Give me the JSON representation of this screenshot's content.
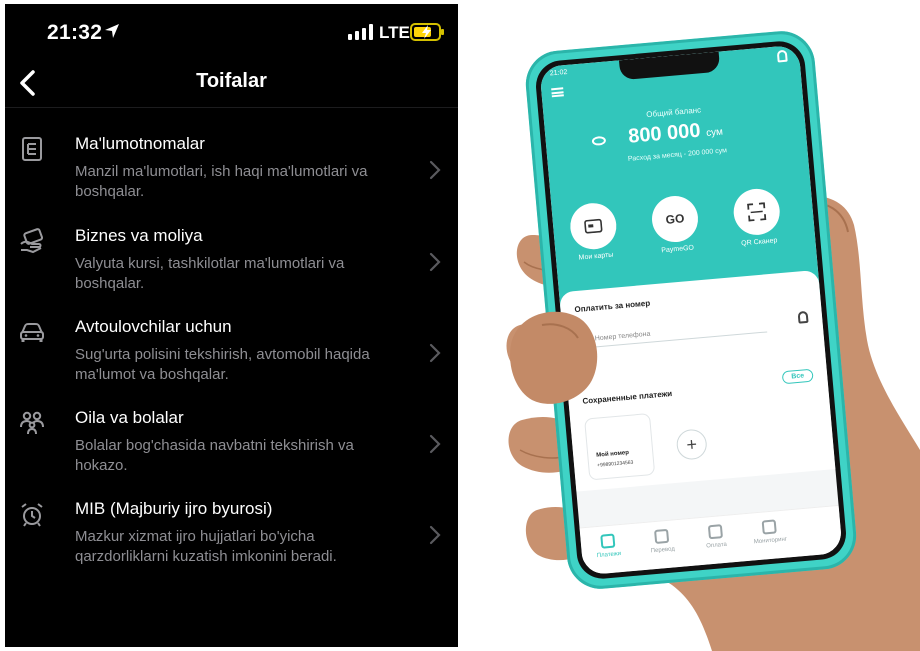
{
  "left": {
    "status": {
      "time": "21:32",
      "network": "LTE"
    },
    "nav": {
      "title": "Toifalar"
    },
    "categories": [
      {
        "title": "Ma'lumotnomalar",
        "description": "Manzil ma'lumotlari, ish haqi ma'lumotlari va boshqalar.",
        "icon": "document-icon"
      },
      {
        "title": "Biznes va moliya",
        "description": "Valyuta kursi, tashkilotlar ma'lumotlari va boshqalar.",
        "icon": "cash-icon"
      },
      {
        "title": "Avtoulovchilar uchun",
        "description": "Sug'urta polisini tekshirish, avtomobil haqida ma'lumot va boshqalar.",
        "icon": "car-icon"
      },
      {
        "title": "Oila va bolalar",
        "description": "Bolalar bog'chasida navbatni tekshirish va hokazo.",
        "icon": "family-icon"
      },
      {
        "title": "MIB (Majburiy ijro byurosi)",
        "description": "Mazkur xizmat ijro hujjatlari bo'yicha qarzdorliklarni kuzatish imkonini beradi.",
        "icon": "alarm-clock-icon"
      }
    ]
  },
  "right": {
    "phone": {
      "status_time": "21:02",
      "balance_label": "Общий баланс",
      "balance_amount": "800 000",
      "balance_currency": "сум",
      "month_expense": "Расход за месяц - 200 000 сум",
      "quick_actions": [
        "Мои карты",
        "PaymeGO",
        "QR Сканер"
      ],
      "quick_go": "GO",
      "pay_title": "Оплатить за номер",
      "pay_placeholder": "+998  Номер телефона",
      "saved_title": "Сохраненные платежи",
      "saved_all": "Все",
      "saved_card_name": "Мой номер",
      "saved_card_phone": "+998901234563",
      "add_symbol": "+",
      "tabs": [
        "Платежи",
        "Перевод",
        "Оплата",
        "Мониторинг"
      ],
      "accent": "#32c6bb"
    }
  }
}
